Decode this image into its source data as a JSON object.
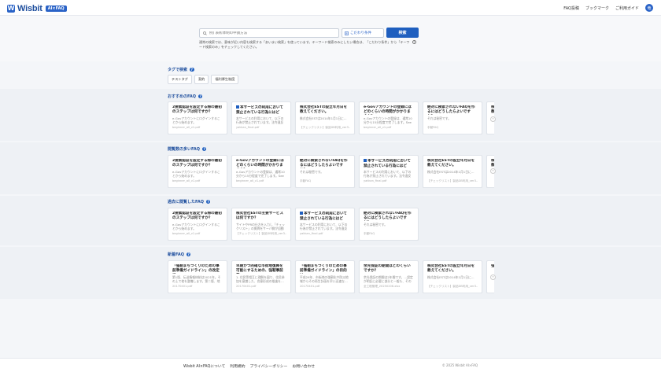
{
  "header": {
    "logo_text": "Wisbit",
    "logo_badge": "AI×FAQ",
    "nav": [
      "FAQ投稿",
      "ブックマーク",
      "ご利用ガイド"
    ],
    "avatar_initial": "竜"
  },
  "search": {
    "placeholder": "例) 表彰体制の申請方法",
    "condition_label": "こだわり条件",
    "button_label": "検索",
    "help_text": "通常の検索では、意味が近い内容も検索する「あいまい検索」を使っています。キーワード検索のみにしたい場合は、「こだわり条件」から「キーワード検索のみ」をチェックしてください。"
  },
  "sections": {
    "tags_title": "タグで検索",
    "tags": [
      "テストタグ",
      "契約",
      "福利厚生制度"
    ],
    "recommended_title": "おすすめのFAQ",
    "popular_title": "閲覧数の多いFAQ",
    "recent_title": "過去に閲覧したFAQ",
    "new_title": "新着FAQ"
  },
  "recommended": [
    {
      "title": "2要素認証を設定する際の最初のステップは何ですか？",
      "body": "e-Govアカウントにログインすることから始めます。",
      "meta": "beginner_all_v1.pdf",
      "mark": false
    },
    {
      "title": "本サービスの利用において禁止されている行為にはどの…",
      "body": "本サービスの利用において、以下の行為が禁止されています。法令違反と…",
      "meta": "yakkan_final.pdf",
      "mark": true
    },
    {
      "title": "株式会社ESTの設立年月日を教えてください。",
      "body": "株式会社ESTは2014年1月1日に…",
      "meta": "【チェックリスト】製品DB利用_ver3…",
      "mark": false
    },
    {
      "title": "e-Govアカウントの登録にはどのくらいの時間がかかりますか？",
      "body": "e-Govアカウントの登録は、通常10分から15分程度で完了します。See MS…",
      "meta": "beginner_all_v1.pdf",
      "mark": false
    },
    {
      "title": "絶対に検索されないFAQを作るにはどうしたらよいですか？",
      "body": "それは秘密です。",
      "meta": "手動FAQ",
      "mark": false
    },
    {
      "title": "株式会社ESTの設立年月日を教えてください。",
      "body": "",
      "meta": "",
      "mark": false
    }
  ],
  "popular": [
    {
      "title": "2要素認証を設定する際の最初のステップは何ですか？",
      "body": "e-Govアカウントにログインすることから始めます。",
      "meta": "beginner_all_v1.pdf",
      "mark": false
    },
    {
      "title": "e-Govアカウントの登録にはどのくらいの時間がかかりますか？",
      "body": "e-Govアカウントの登録は、通常10分から15分程度で完了します。See MS…",
      "meta": "beginner_all_v1.pdf",
      "mark": false
    },
    {
      "title": "絶対に検索されないFAQを作るにはどうしたらよいですか？",
      "body": "それは秘密です。",
      "meta": "手動FAQ",
      "mark": false
    },
    {
      "title": "本サービスの利用において禁止されている行為にはどの…",
      "body": "本サービスの利用において、以下の行為が禁止されています。法令違反と…",
      "meta": "yakkan_final.pdf",
      "mark": true
    },
    {
      "title": "株式会社ESTの設立年月日を教えてください。",
      "body": "株式会社ESTは2014年1月1日に…",
      "meta": "【チェックリスト】製品DB利用_ver3…",
      "mark": false
    },
    {
      "title": "株式会社ESTの設立年月日を教えてください。",
      "body": "",
      "meta": "",
      "mark": false
    }
  ],
  "recent": [
    {
      "title": "2要素認証を設定する際の最初のステップは何ですか？",
      "body": "e-Govアカウントにログインすることから始めます。",
      "meta": "beginner_all_v1.pdf",
      "mark": false
    },
    {
      "title": "株式会社ESTの主要サービスは何ですか？",
      "body": "サイトやPRの仕方を入力し「チェックリスト」の質問をサーバ側が自動添削…",
      "meta": "【チェックリスト】製品DB利用_ver3…",
      "mark": false
    },
    {
      "title": "本サービスの利用において禁止されている行為にはどの…",
      "body": "本サービスの利用において、以下の行為が禁止されています。法令違反と…",
      "meta": "yakkan_final.pdf",
      "mark": true
    },
    {
      "title": "絶対に検索されないFAQを作るにはどうしたらよいですか？",
      "body": "それは秘密です。",
      "meta": "手動FAQ",
      "mark": false
    }
  ],
  "newest": [
    {
      "title": "「強靭まちづくりのための事前準備ガイドライン」の改定で…",
      "body": "第1版、伝送情報体制は2021年。その上で他を整備します。第二版、地域…",
      "meta": "20170401.pdf",
      "mark": false
    },
    {
      "title": "早期かつ的確な市街地復興を可能にするための、強靭事前準…",
      "body": "1. 住民等相互に理解を図り、住民参加を意識した、合意形成の推進を…",
      "meta": "20170401.pdf",
      "mark": false
    },
    {
      "title": "「強靭まちづくりのための事前準備ガイドライン」の目的は…",
      "body": "平成29年、市街地の強靭化や防災地域からその再生計画を早い迅速な…",
      "meta": "20170401.pdf",
      "mark": false
    },
    {
      "title": "余光保証の期間はどのくらいですか？",
      "body": "余光保証の期間は2年間です。…設定が明記に必要に部分と一般も、その効果…",
      "meta": "全工程管理_20250206.xlsx",
      "mark": false
    },
    {
      "title": "株式会社ESTの設立年月日を教えてください。",
      "body": "株式会社ESTは2014年1月1日に…",
      "meta": "【チェックリスト】製品DB利用_ver3…",
      "mark": false
    },
    {
      "title": "強度…",
      "body": "",
      "meta": "",
      "mark": false
    }
  ],
  "footer": {
    "links": [
      "Wisbit AI×FAQについて",
      "利用規約",
      "プライバシーポリシー",
      "お問い合わせ"
    ],
    "copyright": "© 2025 Wisbit AI×FAQ"
  },
  "colors": {
    "accent": "#1f5fbf",
    "band": "#eef1f5"
  },
  "icons": {
    "search": "search-icon",
    "filter": "filter-icon",
    "help": "help-icon",
    "next": "chevron-right-icon"
  }
}
